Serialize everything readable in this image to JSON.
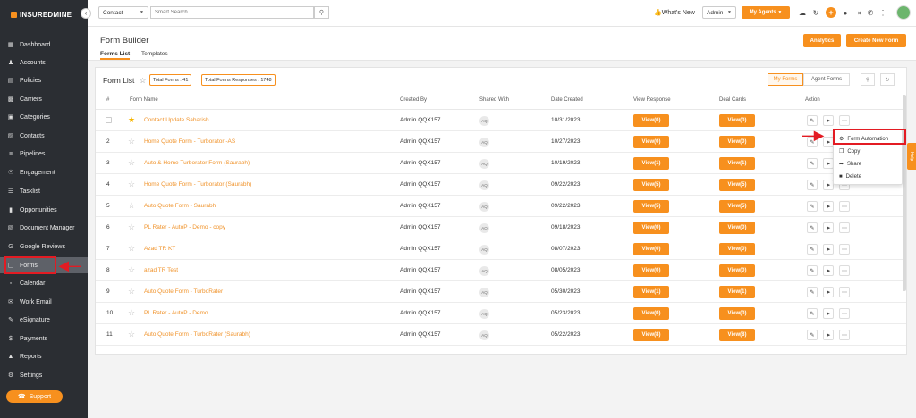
{
  "brand": {
    "logo_text": "INSUREDMINE"
  },
  "sidebar": {
    "items": [
      {
        "label": "Dashboard",
        "icon": "grid-icon"
      },
      {
        "label": "Accounts",
        "icon": "users-icon"
      },
      {
        "label": "Policies",
        "icon": "file-icon"
      },
      {
        "label": "Carriers",
        "icon": "truck-icon"
      },
      {
        "label": "Categories",
        "icon": "folder-icon"
      },
      {
        "label": "Contacts",
        "icon": "contact-icon"
      },
      {
        "label": "Pipelines",
        "icon": "pipeline-icon"
      },
      {
        "label": "Engagement",
        "icon": "engagement-icon"
      },
      {
        "label": "Tasklist",
        "icon": "tasklist-icon"
      },
      {
        "label": "Opportunities",
        "icon": "chart-icon"
      },
      {
        "label": "Document Manager",
        "icon": "document-icon"
      },
      {
        "label": "Google Reviews",
        "icon": "google-icon"
      },
      {
        "label": "Forms",
        "icon": "forms-icon"
      },
      {
        "label": "Calendar",
        "icon": "calendar-icon"
      },
      {
        "label": "Work Email",
        "icon": "email-icon"
      },
      {
        "label": "eSignature",
        "icon": "signature-icon"
      },
      {
        "label": "Payments",
        "icon": "dollar-icon"
      },
      {
        "label": "Reports",
        "icon": "reports-icon"
      },
      {
        "label": "Settings",
        "icon": "gear-icon"
      }
    ],
    "support_label": "Support"
  },
  "topbar": {
    "search_scope": "Contact",
    "search_placeholder": "Smart Search",
    "whats_new": "What's New",
    "role": "Admin",
    "my_agents": "My Agents"
  },
  "page": {
    "title": "Form Builder",
    "tabs": [
      "Forms List",
      "Templates"
    ],
    "analytics_btn": "Analytics",
    "create_btn": "Create New Form"
  },
  "formlist": {
    "title": "Form List",
    "total_forms": "Total Forms : 41",
    "total_responses": "Total Forms Responses : 1748",
    "my_forms": "My Forms",
    "agent_forms": "Agent Forms",
    "columns": [
      "#",
      "Form Name",
      "Created By",
      "Shared With",
      "Date Created",
      "View Response",
      "Deal Cards",
      "Action"
    ],
    "rows": [
      {
        "num": "",
        "name": "Contact Update Sabarish",
        "created_by": "Admin QQX157",
        "shared": "AQ",
        "date": "10/31/2023",
        "view": "View(0)",
        "deal": "View(0)"
      },
      {
        "num": "2",
        "name": "Home Quote Form - Turborator -AS",
        "created_by": "Admin QQX157",
        "shared": "AQ",
        "date": "10/27/2023",
        "view": "View(0)",
        "deal": "View(0)"
      },
      {
        "num": "3",
        "name": "Auto & Home Turborator Form (Saurabh)",
        "created_by": "Admin QQX157",
        "shared": "AQ",
        "date": "10/19/2023",
        "view": "View(1)",
        "deal": "View(1)"
      },
      {
        "num": "4",
        "name": "Home Quote Form - Turborator (Saurabh)",
        "created_by": "Admin QQX157",
        "shared": "AQ",
        "date": "09/22/2023",
        "view": "View(5)",
        "deal": "View(5)"
      },
      {
        "num": "5",
        "name": "Auto Quote Form - Saurabh",
        "created_by": "Admin QQX157",
        "shared": "AQ",
        "date": "09/22/2023",
        "view": "View(5)",
        "deal": "View(5)"
      },
      {
        "num": "6",
        "name": "PL Rater - AutoP - Demo - copy",
        "created_by": "Admin QQX157",
        "shared": "AQ",
        "date": "09/18/2023",
        "view": "View(0)",
        "deal": "View(0)"
      },
      {
        "num": "7",
        "name": "Azad TR KT",
        "created_by": "Admin QQX157",
        "shared": "AQ",
        "date": "08/07/2023",
        "view": "View(0)",
        "deal": "View(0)"
      },
      {
        "num": "8",
        "name": "azad TR Test",
        "created_by": "Admin QQX157",
        "shared": "AQ",
        "date": "08/05/2023",
        "view": "View(0)",
        "deal": "View(0)"
      },
      {
        "num": "9",
        "name": "Auto Quote Form - TurboRater",
        "created_by": "Admin QQX157",
        "shared": "AQ",
        "date": "05/30/2023",
        "view": "View(1)",
        "deal": "View(1)"
      },
      {
        "num": "10",
        "name": "PL Rater - AutoP - Demo",
        "created_by": "Admin QQX157",
        "shared": "AQ",
        "date": "05/23/2023",
        "view": "View(0)",
        "deal": "View(0)"
      },
      {
        "num": "11",
        "name": "Auto Quote Form - TurboRater (Saurabh)",
        "created_by": "Admin QQX157",
        "shared": "AQ",
        "date": "05/22/2023",
        "view": "View(8)",
        "deal": "View(8)"
      }
    ]
  },
  "dropdown": {
    "items": [
      "Form Automation",
      "Copy",
      "Share",
      "Delete"
    ]
  },
  "help_tab": "Help",
  "colors": {
    "accent": "#f7901e",
    "sidebar": "#2b2e33",
    "highlight": "#e31b23"
  }
}
